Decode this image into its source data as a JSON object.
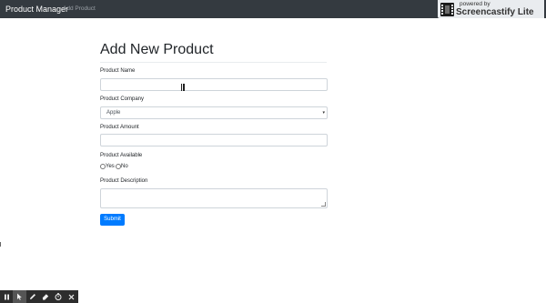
{
  "navbar": {
    "brand": "Product Manager",
    "link_add_product": "Add Product"
  },
  "watermark": {
    "powered_by": "powered by",
    "name": "Screencastify Lite"
  },
  "form": {
    "title": "Add New Product",
    "product_name": {
      "label": "Product Name",
      "value": ""
    },
    "product_company": {
      "label": "Product Company",
      "selected": "Apple"
    },
    "product_amount": {
      "label": "Product Amount",
      "value": ""
    },
    "product_available": {
      "label": "Product Available",
      "options": [
        "Yes",
        "No"
      ]
    },
    "product_description": {
      "label": "Product Description",
      "value": ""
    },
    "submit_label": "Submit"
  },
  "toolbar": {
    "icons": [
      "pause-icon",
      "pointer-icon",
      "pen-icon",
      "eraser-icon",
      "timer-icon",
      "close-icon"
    ]
  }
}
